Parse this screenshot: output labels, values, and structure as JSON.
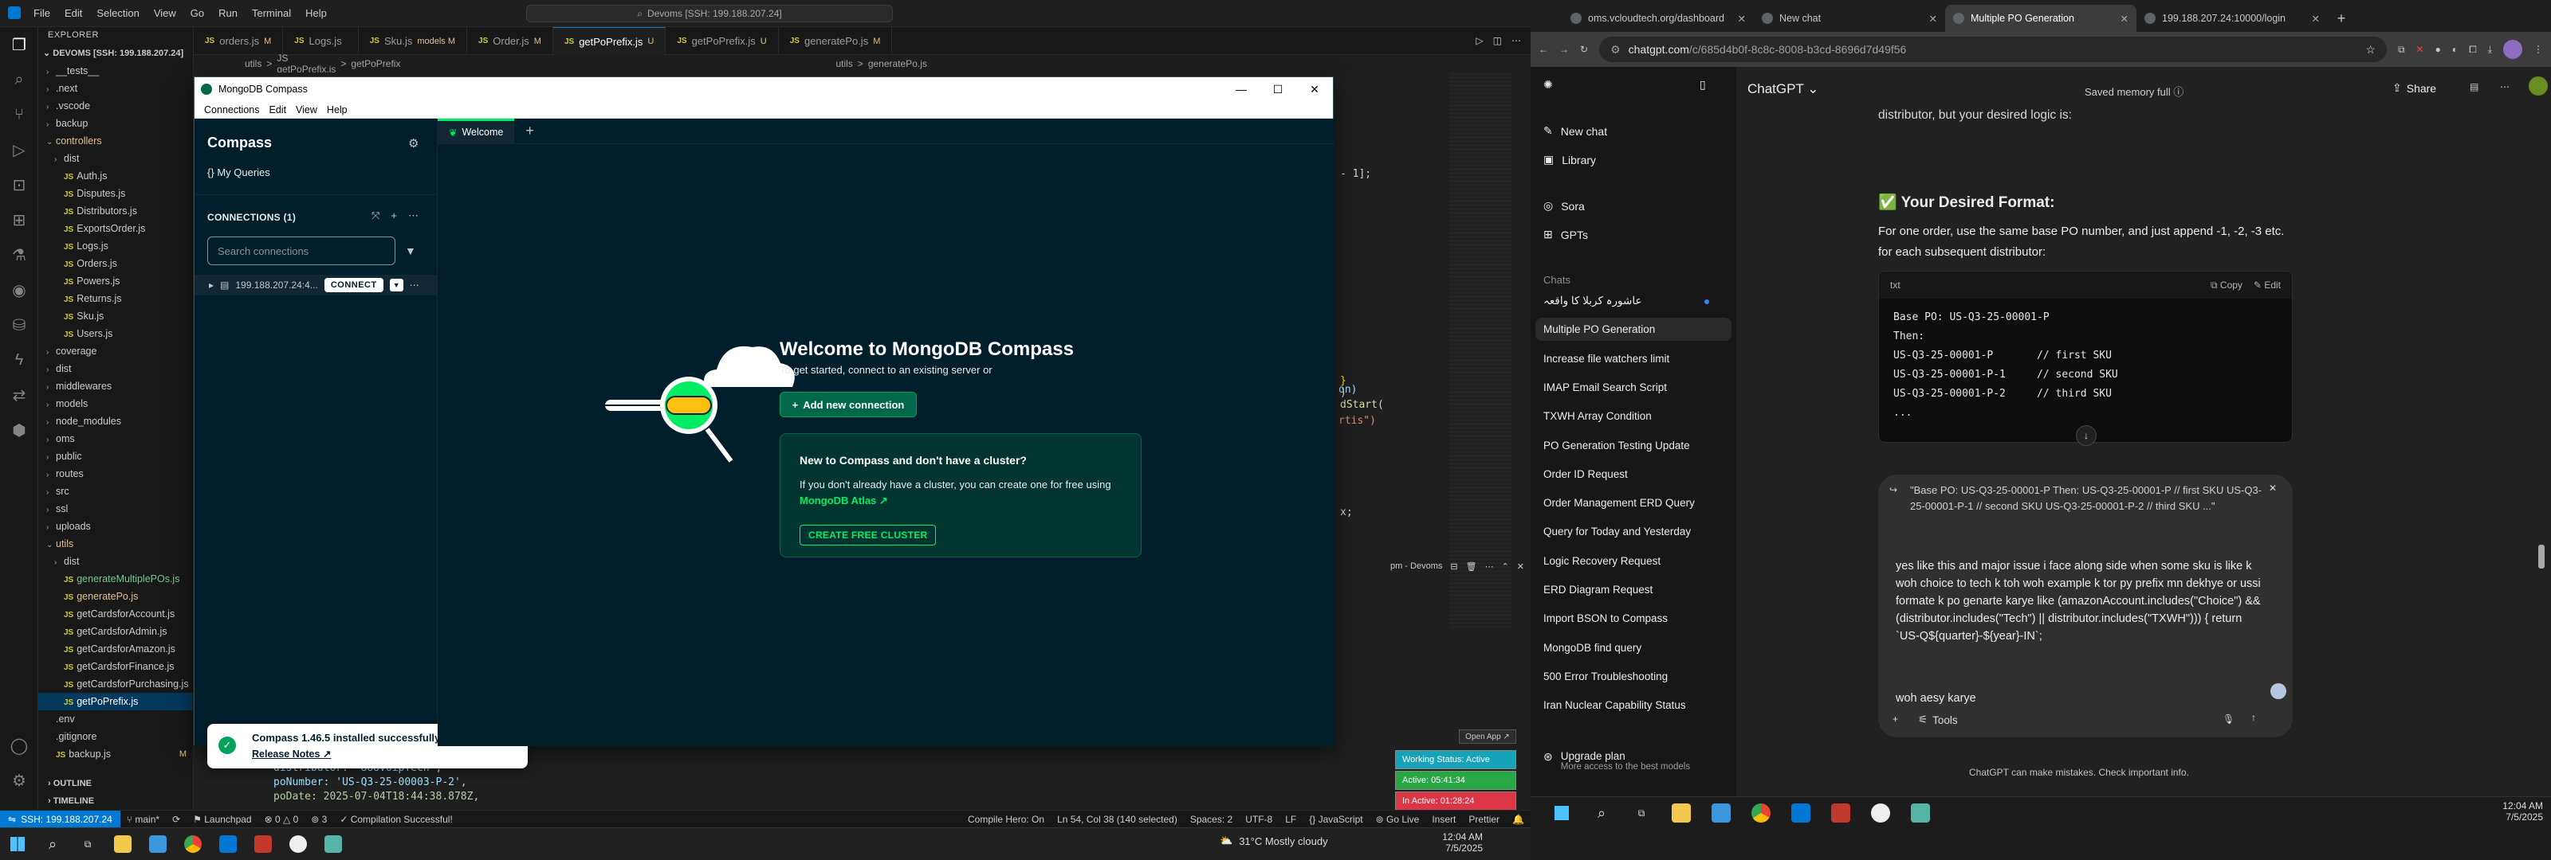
{
  "vscode": {
    "menu": [
      "File",
      "Edit",
      "Selection",
      "View",
      "Go",
      "Run",
      "Terminal",
      "Help"
    ],
    "search": "Devoms [SSH: 199.188.207.24]",
    "explorer_title": "EXPLORER",
    "project": "DEVOMS [SSH: 199.188.207.24]",
    "tree": [
      {
        "name": "__tests__",
        "type": "folder",
        "indent": 1
      },
      {
        "name": ".next",
        "type": "folder",
        "indent": 1
      },
      {
        "name": ".vscode",
        "type": "folder",
        "indent": 1
      },
      {
        "name": "backup",
        "type": "folder",
        "indent": 1
      },
      {
        "name": "controllers",
        "type": "folder-open",
        "indent": 1,
        "color": "yellow"
      },
      {
        "name": "dist",
        "type": "folder",
        "indent": 2
      },
      {
        "name": "Auth.js",
        "type": "js",
        "indent": 2
      },
      {
        "name": "Disputes.js",
        "type": "js",
        "indent": 2
      },
      {
        "name": "Distributors.js",
        "type": "js",
        "indent": 2
      },
      {
        "name": "ExportsOrder.js",
        "type": "js",
        "indent": 2
      },
      {
        "name": "Logs.js",
        "type": "js",
        "indent": 2
      },
      {
        "name": "Orders.js",
        "type": "js",
        "indent": 2
      },
      {
        "name": "Powers.js",
        "type": "js",
        "indent": 2
      },
      {
        "name": "Returns.js",
        "type": "js",
        "indent": 2
      },
      {
        "name": "Sku.js",
        "type": "js",
        "indent": 2
      },
      {
        "name": "Users.js",
        "type": "js",
        "indent": 2
      },
      {
        "name": "coverage",
        "type": "folder",
        "indent": 1
      },
      {
        "name": "dist",
        "type": "folder",
        "indent": 1
      },
      {
        "name": "middlewares",
        "type": "folder",
        "indent": 1
      },
      {
        "name": "models",
        "type": "folder",
        "indent": 1
      },
      {
        "name": "node_modules",
        "type": "folder",
        "indent": 1
      },
      {
        "name": "oms",
        "type": "folder",
        "indent": 1
      },
      {
        "name": "public",
        "type": "folder",
        "indent": 1
      },
      {
        "name": "routes",
        "type": "folder",
        "indent": 1
      },
      {
        "name": "src",
        "type": "folder",
        "indent": 1
      },
      {
        "name": "ssl",
        "type": "folder",
        "indent": 1
      },
      {
        "name": "uploads",
        "type": "folder",
        "indent": 1
      },
      {
        "name": "utils",
        "type": "folder-open",
        "indent": 1,
        "color": "yellow"
      },
      {
        "name": "dist",
        "type": "folder",
        "indent": 2
      },
      {
        "name": "generateMultiplePOs.js",
        "type": "js",
        "indent": 2,
        "color": "green"
      },
      {
        "name": "generatePo.js",
        "type": "js",
        "indent": 2,
        "color": "yellow"
      },
      {
        "name": "getCardsforAccount.js",
        "type": "js",
        "indent": 2
      },
      {
        "name": "getCardsforAdmin.js",
        "type": "js",
        "indent": 2
      },
      {
        "name": "getCardsforAmazon.js",
        "type": "js",
        "indent": 2
      },
      {
        "name": "getCardsforFinance.js",
        "type": "js",
        "indent": 2
      },
      {
        "name": "getCardsforPurchasing.js",
        "type": "js",
        "indent": 2
      },
      {
        "name": "getPoPrefix.js",
        "type": "js",
        "indent": 2,
        "sel": true
      },
      {
        "name": ".env",
        "type": "file",
        "indent": 1
      },
      {
        "name": ".gitignore",
        "type": "file",
        "indent": 1
      },
      {
        "name": "backup.js",
        "type": "js",
        "indent": 1,
        "mod": "M"
      }
    ],
    "outline": "OUTLINE",
    "timeline": "TIMELINE",
    "tabs": [
      {
        "label": "orders.js",
        "mod": "M"
      },
      {
        "label": "Logs.js",
        "mod": ""
      },
      {
        "label": "Sku.js",
        "mod": "models M"
      },
      {
        "label": "Order.js",
        "mod": "M"
      },
      {
        "label": "getPoPrefix.js",
        "mod": "U",
        "active": true
      },
      {
        "label": "getPoPrefix.js",
        "mod": "U"
      },
      {
        "label": "generatePo.js",
        "mod": "M"
      }
    ],
    "breadcrumb": [
      "utils",
      ">",
      "JS getPoPrefix.js",
      ">",
      "getPoPrefix"
    ],
    "breadcrumb2": [
      "utils",
      ">",
      "generatePo.js"
    ],
    "code_frag": [
      "- 1];",
      ")",
      "}",
      "on)",
      "dStart(",
      "rtis\")",
      "x;"
    ],
    "code_bottom": [
      "{",
      "distributor: '888VoipTech',",
      "poNumber: 'US-Q3-25-00003-P-2',",
      "poDate: 2025-07-04T18:44:38.878Z,"
    ],
    "term_label": "pm - Devoms",
    "status": {
      "remote": "SSH: 199.188.207.24",
      "branch": "main*",
      "sync": "⟳",
      "launchpad": "Launchpad",
      "problems": "⊗ 0 △ 0",
      "ports": "3",
      "compile": "✓ Compilation Successful!",
      "compile_hero": "Compile Hero: On",
      "cursor": "Ln 54, Col 38 (140 selected)",
      "spaces": "Spaces: 2",
      "encoding": "UTF-8",
      "eol": "LF",
      "language": "{} JavaScript",
      "golive": "Go Live",
      "insert": "Insert",
      "prettier": "Prettier"
    },
    "open_app": "Open App ↗",
    "work_status": "Working Status: Active",
    "active_time": "Active: 05:41:34",
    "inactive_time": "In Active: 01:28:24",
    "weather": "31°C  Mostly cloudy",
    "clock_time": "12:04 AM",
    "clock_date": "7/5/2025"
  },
  "compass": {
    "title": "MongoDB Compass",
    "menu": [
      "Connections",
      "Edit",
      "View",
      "Help"
    ],
    "brand": "Compass",
    "my_queries": "My Queries",
    "connections_header": "CONNECTIONS (1)",
    "search_placeholder": "Search connections",
    "connection_host": "199.188.207.24:4...",
    "connect_label": "CONNECT",
    "tab_welcome": "Welcome",
    "welcome_heading": "Welcome to MongoDB Compass",
    "welcome_sub": "To get started, connect to an existing server or",
    "add_connection": "Add new connection",
    "card_heading": "New to Compass and don't have a cluster?",
    "card_text": "If you don't already have a cluster, you can create one for free using",
    "card_link": "MongoDB Atlas",
    "card_button": "CREATE FREE CLUSTER",
    "toast_title": "Compass 1.46.5 installed successfully",
    "toast_link": "Release Notes"
  },
  "chrome": {
    "tabs": [
      {
        "label": "oms.vcloudtech.org/dashboard"
      },
      {
        "label": "New chat"
      },
      {
        "label": "Multiple PO Generation",
        "active": true
      },
      {
        "label": "199.188.207.24:10000/login"
      }
    ],
    "url_host": "chatgpt.com",
    "url_path": "/c/685d4b0f-8c8c-8008-b3cd-8696d7d49f56"
  },
  "gpt": {
    "side_top": [
      "New chat",
      "Library",
      "Sora",
      "GPTs"
    ],
    "chats_label": "Chats",
    "chats": [
      "عاشورہ کربلا کا واقعہ",
      "Multiple PO Generation",
      "Increase file watchers limit",
      "IMAP Email Search Script",
      "TXWH Array Condition",
      "PO Generation Testing Update",
      "Order ID Request",
      "Order Management ERD Query",
      "Query for Today and Yesterday",
      "Logic Recovery Request",
      "ERD Diagram Request",
      "Import BSON to Compass",
      "MongoDB find query",
      "500 Error Troubleshooting",
      "Iran Nuclear Capability Status"
    ],
    "upgrade_title": "Upgrade plan",
    "upgrade_sub": "More access to the best models",
    "model": "ChatGPT ⌄",
    "memory": "Saved memory full  ⓘ",
    "share": "Share",
    "top_line": "distributor, but your desired logic is:",
    "section_title": "✅ Your Desired Format:",
    "para_1": "For one order, use the same base PO number, and just append -1, -2, -3 etc. for each subsequent distributor:",
    "code_lang": "txt",
    "code_copy": "Copy",
    "code_edit": "Edit",
    "code_lines": [
      "Base PO: US-Q3-25-00001-P",
      "Then:",
      "US-Q3-25-00001-P       // first SKU",
      "US-Q3-25-00001-P-1     // second SKU",
      "US-Q3-25-00001-P-2     // third SKU",
      "..."
    ],
    "quote": "\"Base PO: US-Q3-25-00001-P Then: US-Q3-25-00001-P // first SKU US-Q3-25-00001-P-1 // second SKU US-Q3-25-00001-P-2 // third SKU ...\"",
    "user_text": "yes like this and major issue i face along side when some sku is like k woh choice to tech k toh woh example k tor py prefix mn dekhye or ussi formate k po genarte karye like (amazonAccount.includes(\"Choice\") && (distributor.includes(\"Tech\") || distributor.includes(\"TXWH\"))) { return `US-Q${quarter}-${year}-IN`;",
    "user_text_2": "woh aesy karye",
    "tools": "Tools",
    "footer": "ChatGPT can make mistakes. Check important info."
  },
  "taskbar_right": {
    "time": "12:04 AM",
    "date": "7/5/2025"
  }
}
